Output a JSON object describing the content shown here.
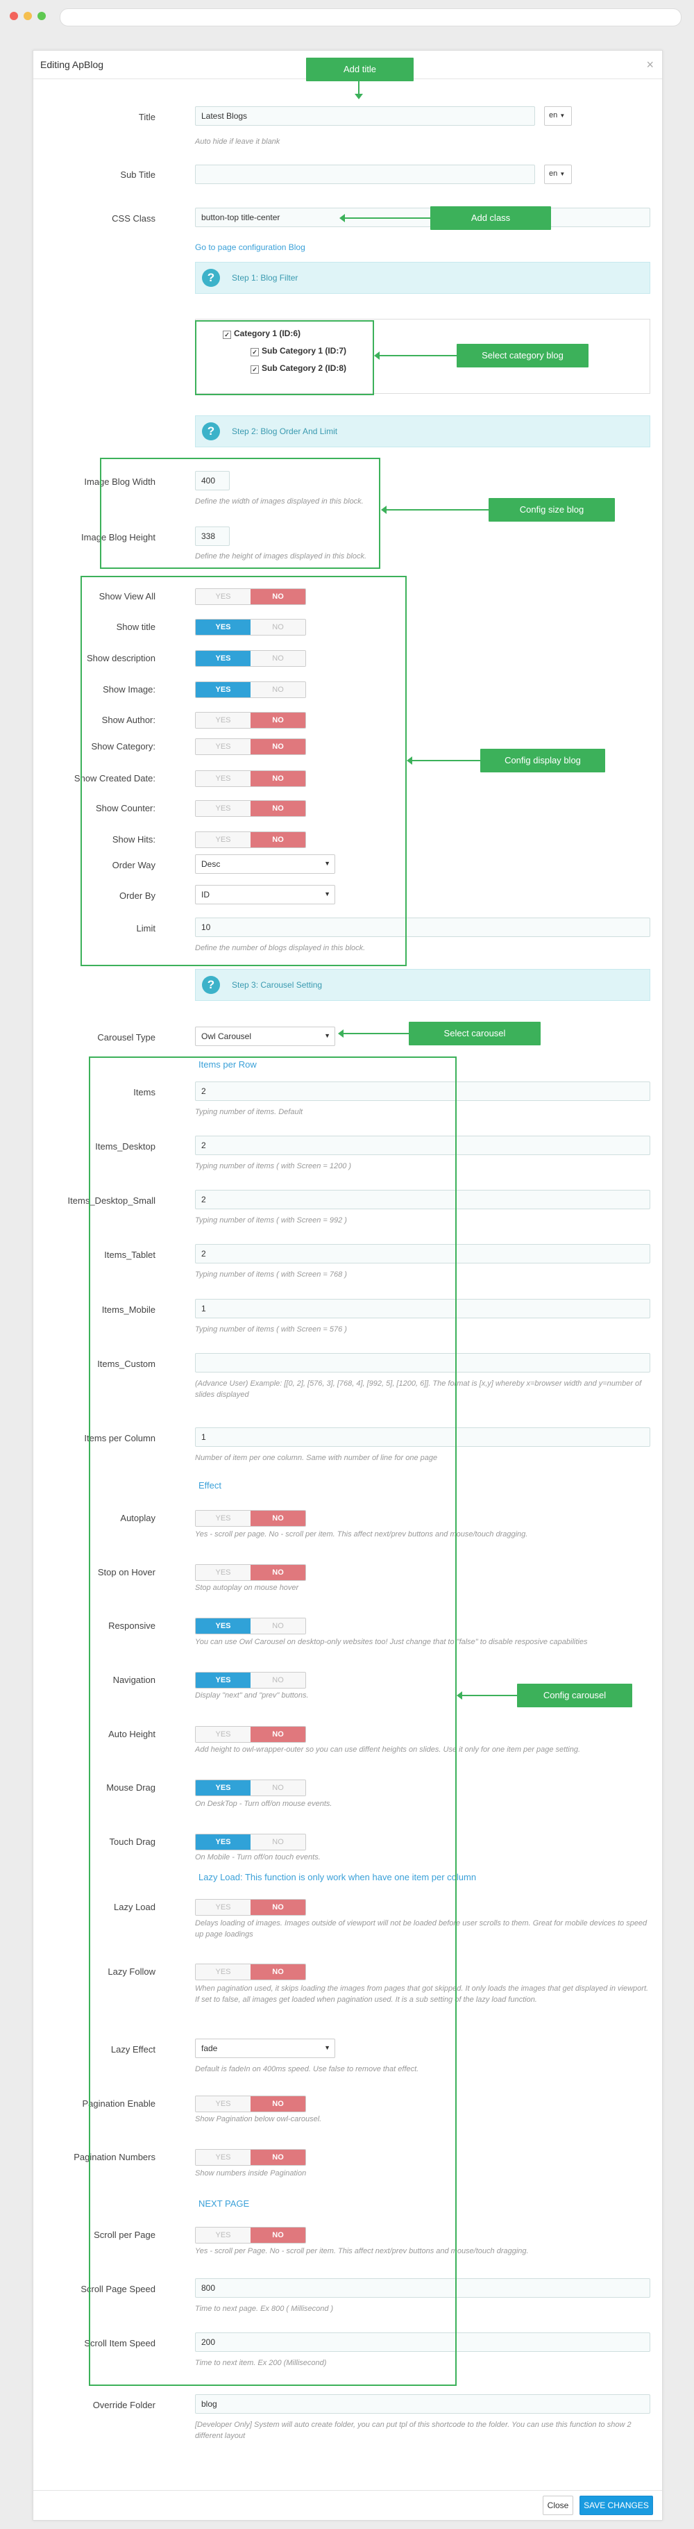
{
  "colors": {
    "accent": "#30a2d8",
    "no_red": "#e0787d",
    "annotation_green": "#3cb15a",
    "step_bg": "#dff4f7"
  },
  "window": {
    "title": "Editing ApBlog",
    "close_icon": "×"
  },
  "annotations": {
    "add_title": "Add title",
    "add_class": "Add class",
    "select_category": "Select category blog",
    "config_size": "Config size blog",
    "config_display": "Config display blog",
    "select_carousel": "Select carousel",
    "config_carousel": "Config carousel"
  },
  "form": {
    "title": {
      "label": "Title",
      "value": "Latest Blogs",
      "lang": "en",
      "help": "Auto hide if leave it blank"
    },
    "sub_title": {
      "label": "Sub Title",
      "value": "",
      "lang": "en"
    },
    "css_class": {
      "label": "CSS Class",
      "value": "button-top title-center"
    },
    "config_link": "Go to page configuration Blog",
    "step1": "Step 1: Blog Filter",
    "categories": [
      {
        "label": "Category 1 (ID:6)",
        "checked": "✓"
      },
      {
        "label": "Sub Category 1 (ID:7)",
        "checked": "✓"
      },
      {
        "label": "Sub Category 2 (ID:8)",
        "checked": "✓"
      }
    ],
    "step2": "Step 2: Blog Order And Limit",
    "image_width": {
      "label": "Image Blog Width",
      "value": "400",
      "help": "Define the width of images displayed in this block."
    },
    "image_height": {
      "label": "Image Blog Height",
      "value": "338",
      "help": "Define the height of images displayed in this block."
    },
    "toggles_display": [
      {
        "label": "Show View All",
        "yes": "YES",
        "no": "NO",
        "state": "no"
      },
      {
        "label": "Show title",
        "yes": "YES",
        "no": "NO",
        "state": "yes"
      },
      {
        "label": "Show description",
        "yes": "YES",
        "no": "NO",
        "state": "yes"
      },
      {
        "label": "Show Image:",
        "yes": "YES",
        "no": "NO",
        "state": "yes"
      },
      {
        "label": "Show Author:",
        "yes": "YES",
        "no": "NO",
        "state": "no"
      },
      {
        "label": "Show Category:",
        "yes": "YES",
        "no": "NO",
        "state": "no"
      },
      {
        "label": "Show Created Date:",
        "yes": "YES",
        "no": "NO",
        "state": "no"
      },
      {
        "label": "Show Counter:",
        "yes": "YES",
        "no": "NO",
        "state": "no"
      },
      {
        "label": "Show Hits:",
        "yes": "YES",
        "no": "NO",
        "state": "no"
      }
    ],
    "order_way": {
      "label": "Order Way",
      "value": "Desc"
    },
    "order_by": {
      "label": "Order By",
      "value": "ID"
    },
    "limit": {
      "label": "Limit",
      "value": "10",
      "help": "Define the number of blogs displayed in this block."
    },
    "step3": "Step 3: Carousel Setting",
    "carousel_type": {
      "label": "Carousel Type",
      "value": "Owl Carousel"
    },
    "items_per_row_head": "Items per Row",
    "items": {
      "label": "Items",
      "value": "2",
      "help": "Typing number of items. Default"
    },
    "items_desktop": {
      "label": "Items_Desktop",
      "value": "2",
      "help": "Typing number of items ( with Screen = 1200 )"
    },
    "items_desktop_small": {
      "label": "Items_Desktop_Small",
      "value": "2",
      "help": "Typing number of items ( with Screen = 992 )"
    },
    "items_tablet": {
      "label": "Items_Tablet",
      "value": "2",
      "help": "Typing number of items ( with Screen = 768 )"
    },
    "items_mobile": {
      "label": "Items_Mobile",
      "value": "1",
      "help": "Typing number of items ( with Screen = 576 )"
    },
    "items_custom": {
      "label": "Items_Custom",
      "value": "",
      "help": "(Advance User) Example: [[0, 2], [576, 3], [768, 4], [992, 5], [1200, 6]]. The format is [x,y] whereby x=browser width and y=number of slides displayed"
    },
    "items_per_column": {
      "label": "Items per Column",
      "value": "1",
      "help": "Number of item per one column. Same with number of line for one page"
    },
    "effect_head": "Effect",
    "autoplay": {
      "label": "Autoplay",
      "yes": "YES",
      "no": "NO",
      "state": "no",
      "help": "Yes - scroll per page. No - scroll per item. This affect next/prev buttons and mouse/touch dragging."
    },
    "stop_on_hover": {
      "label": "Stop on Hover",
      "yes": "YES",
      "no": "NO",
      "state": "no",
      "help": "Stop autoplay on mouse hover"
    },
    "responsive": {
      "label": "Responsive",
      "yes": "YES",
      "no": "NO",
      "state": "yes",
      "help": "You can use Owl Carousel on desktop-only websites too! Just change that to \"false\" to disable resposive capabilities"
    },
    "navigation": {
      "label": "Navigation",
      "yes": "YES",
      "no": "NO",
      "state": "yes",
      "help": "Display \"next\" and \"prev\" buttons."
    },
    "auto_height": {
      "label": "Auto Height",
      "yes": "YES",
      "no": "NO",
      "state": "no",
      "help": "Add height to owl-wrapper-outer so you can use diffent heights on slides. Use it only for one item per page setting."
    },
    "mouse_drag": {
      "label": "Mouse Drag",
      "yes": "YES",
      "no": "NO",
      "state": "yes",
      "help": "On DeskTop - Turn off/on mouse events."
    },
    "touch_drag": {
      "label": "Touch Drag",
      "yes": "YES",
      "no": "NO",
      "state": "yes",
      "help": "On Mobile - Turn off/on touch events."
    },
    "lazy_head": "Lazy Load: This function is only work when have one item per column",
    "lazy_load": {
      "label": "Lazy Load",
      "yes": "YES",
      "no": "NO",
      "state": "no",
      "help": "Delays loading of images. Images outside of viewport will not be loaded before user scrolls to them. Great for mobile devices to speed up page loadings"
    },
    "lazy_follow": {
      "label": "Lazy Follow",
      "yes": "YES",
      "no": "NO",
      "state": "no",
      "help": "When pagination used, it skips loading the images from pages that got skipped. It only loads the images that get displayed in viewport. If set to false, all images get loaded when pagination used. It is a sub setting of the lazy load function."
    },
    "lazy_effect": {
      "label": "Lazy Effect",
      "value": "fade",
      "help": "Default is fadeIn on 400ms speed. Use false to remove that effect."
    },
    "pagination_enable": {
      "label": "Pagination Enable",
      "yes": "YES",
      "no": "NO",
      "state": "no",
      "help": "Show Pagination below owl-carousel."
    },
    "pagination_numbers": {
      "label": "Pagination Numbers",
      "yes": "YES",
      "no": "NO",
      "state": "no",
      "help": "Show numbers inside Pagination"
    },
    "next_page_head": "NEXT PAGE",
    "scroll_per_page": {
      "label": "Scroll per Page",
      "yes": "YES",
      "no": "NO",
      "state": "no",
      "help": "Yes - scroll per Page. No - scroll per item. This affect next/prev buttons and mouse/touch dragging."
    },
    "scroll_page_speed": {
      "label": "Scroll Page Speed",
      "value": "800",
      "help": "Time to next page. Ex 800 ( Millisecond )"
    },
    "scroll_item_speed": {
      "label": "Scroll Item Speed",
      "value": "200",
      "help": "Time to next item. Ex 200 (Millisecond)"
    },
    "override_folder": {
      "label": "Override Folder",
      "value": "blog",
      "help": "[Developer Only] System will auto create folder, you can put tpl of this shortcode to the folder. You can use this function to show 2 different layout"
    }
  },
  "footer": {
    "close": "Close",
    "save": "SAVE CHANGES"
  },
  "icons": {
    "caret": "▼",
    "help_mark": "?"
  }
}
